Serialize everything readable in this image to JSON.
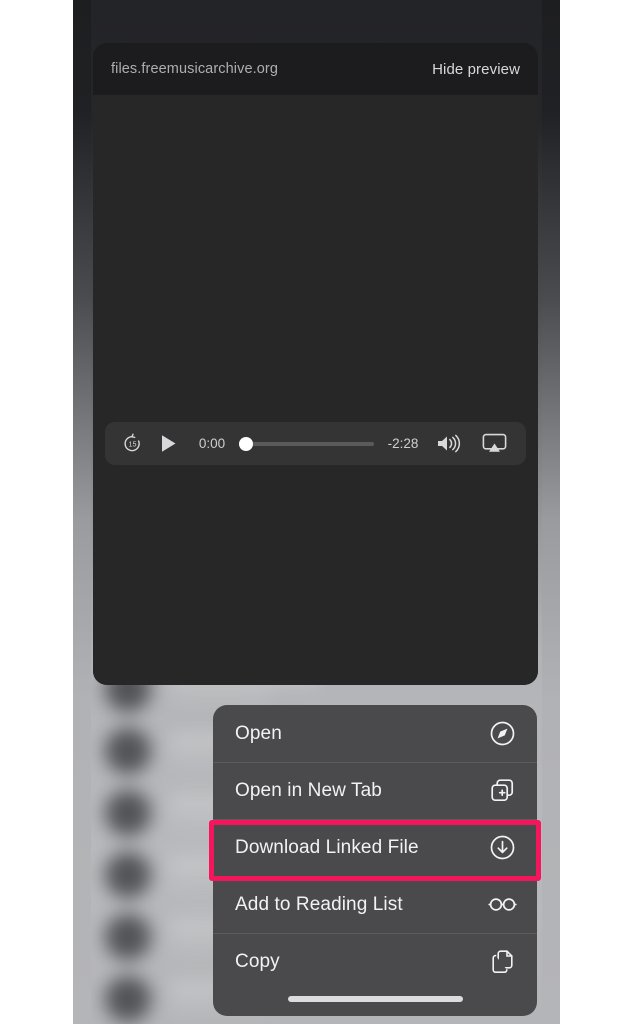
{
  "preview": {
    "url": "files.freemusicarchive.org",
    "hide_label": "Hide preview"
  },
  "player": {
    "skip_back_icon": "skip-back-15-icon",
    "skip_back_seconds": "15",
    "play_icon": "play-icon",
    "time_elapsed": "0:00",
    "time_remaining": "-2:28",
    "progress_percent": 0,
    "volume_icon": "volume-high-icon",
    "airplay_icon": "airplay-icon"
  },
  "context_menu": {
    "items": [
      {
        "label": "Open",
        "icon": "compass-icon",
        "highlighted": false
      },
      {
        "label": "Open in New Tab",
        "icon": "new-tab-icon",
        "highlighted": false
      },
      {
        "label": "Download Linked File",
        "icon": "download-circle-icon",
        "highlighted": true
      },
      {
        "label": "Add to Reading List",
        "icon": "glasses-icon",
        "highlighted": false
      },
      {
        "label": "Copy",
        "icon": "copy-icon",
        "highlighted": false
      }
    ]
  },
  "annotation": {
    "highlight_color": "#f4155c",
    "target_label": "Download Linked File"
  },
  "colors": {
    "preview_bg": "#282828",
    "preview_header_bg": "#1c1c1e",
    "menu_bg": "#4a4a4c",
    "controls_bg": "#343434"
  }
}
